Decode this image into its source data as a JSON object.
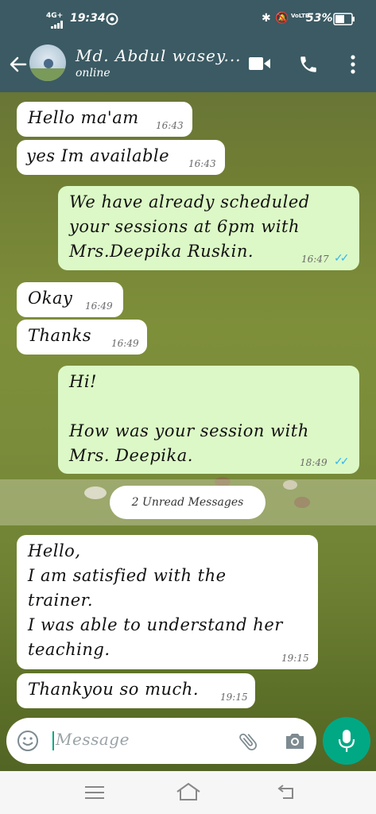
{
  "status_bar": {
    "network": "4G+",
    "time": "19:34",
    "volte": "VoLTE",
    "battery": "53%"
  },
  "header": {
    "contact_name": "Md. Abdul wasey...",
    "presence": "online"
  },
  "messages": [
    {
      "dir": "in",
      "text": "Hello ma'am",
      "time": "16:43"
    },
    {
      "dir": "in",
      "text": "yes Im available",
      "time": "16:43"
    },
    {
      "dir": "out",
      "text": "We have already scheduled\nyour sessions at 6pm with\nMrs.Deepika Ruskin.",
      "time": "16:47",
      "ticks": "✓✓"
    },
    {
      "dir": "in",
      "text": "Okay",
      "time": "16:49"
    },
    {
      "dir": "in",
      "text": "Thanks",
      "time": "16:49"
    },
    {
      "dir": "out",
      "text": "Hi!\n\nHow was your session with\nMrs. Deepika.",
      "time": "18:49",
      "ticks": "✓✓"
    },
    {
      "dir": "in",
      "text": "Hello,\nI am satisfied with the\ntrainer.\nI was able to understand her\nteaching.",
      "time": "19:15"
    },
    {
      "dir": "in",
      "text": "Thankyou so much.",
      "time": "19:15"
    }
  ],
  "unread_banner": "2 Unread Messages",
  "composer": {
    "placeholder": "Message"
  },
  "colors": {
    "header": "#3b5a63",
    "outgoing_bubble": "#dcf8c6",
    "incoming_bubble": "#ffffff",
    "mic_button": "#00a884",
    "read_ticks": "#34b7f1"
  }
}
